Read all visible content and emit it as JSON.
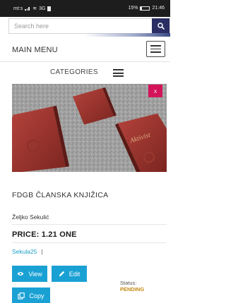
{
  "status_bar": {
    "carrier": "mt:s",
    "network": "3G",
    "battery": "15%",
    "time": "21:46"
  },
  "search": {
    "placeholder": "Search here",
    "icon": "search-icon"
  },
  "menu": {
    "title": "MAIN MENU",
    "icon": "hamburger-icon"
  },
  "categories": {
    "label": "CATEGORIES",
    "icon": "hamburger-icon"
  },
  "listing": {
    "close_label": "x",
    "title": "FDGB ČLANSKA KNJIŽICA",
    "author": "Željko Sekulić",
    "price": "PRICE: 1.21 ONE",
    "username": "Sekula25",
    "separator": "|",
    "book_text": "Aktivist"
  },
  "actions": {
    "view_label": "View",
    "edit_label": "Edit",
    "copy_label": "Copy"
  },
  "status": {
    "label": "Status:",
    "value": "PENDING"
  },
  "colors": {
    "brand_navy": "#2b2e63",
    "accent_blue": "#1aa1d4",
    "close_red": "#d4145a",
    "pending": "#c58a12"
  }
}
